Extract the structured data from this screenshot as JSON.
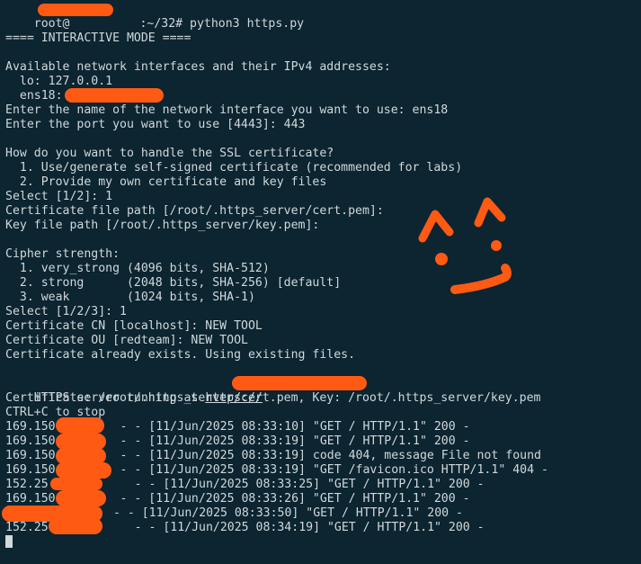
{
  "terminal": {
    "prompt_user": "root@",
    "prompt_path": ":~/32# ",
    "command": "python3 https.py",
    "mode_banner": "==== INTERACTIVE MODE ====",
    "iface_header": "Available network interfaces and their IPv4 addresses:",
    "iface_lo": "  lo: 127.0.0.1",
    "iface_ens18": "  ens18: ",
    "ask_iface": "Enter the name of the network interface you want to use: ens18",
    "ask_port": "Enter the port you want to use [4443]: 443",
    "ssl_question": "How do you want to handle the SSL certificate?",
    "ssl_opt1": "  1. Use/generate self-signed certificate (recommended for labs)",
    "ssl_opt2": "  2. Provide my own certificate and key files",
    "ssl_select": "Select [1/2]: 1",
    "cert_path": "Certificate file path [/root/.https_server/cert.pem]:",
    "key_path": "Key file path [/root/.https_server/key.pem]:",
    "cipher_header": "Cipher strength:",
    "cipher_1": "  1. very_strong (4096 bits, SHA-512)",
    "cipher_2": "  2. strong      (2048 bits, SHA-256) [default]",
    "cipher_3": "  3. weak        (1024 bits, SHA-1)",
    "cipher_select": "Select [1/2/3]: 1",
    "cert_cn": "Certificate CN [localhost]: NEW TOOL",
    "cert_ou": "Certificate OU [redteam]: NEW TOOL",
    "cert_exists": "Certificate already exists. Using existing files.",
    "running_prefix": "HTTPS server running at ",
    "running_link": "https://",
    "cert_key_info": "Certificate: /root/.https_server/cert.pem, Key: /root/.https_server/key.pem",
    "ctrl_c": "CTRL+C to stop",
    "logs": [
      {
        "ip": "169.150",
        "rest": " - - [11/Jun/2025 08:33:10] \"GET / HTTP/1.1\" 200 -"
      },
      {
        "ip": "169.150",
        "rest": " - - [11/Jun/2025 08:33:19] \"GET / HTTP/1.1\" 200 -"
      },
      {
        "ip": "169.150",
        "rest": " - - [11/Jun/2025 08:33:19] code 404, message File not found"
      },
      {
        "ip": "169.150",
        "rest": " - - [11/Jun/2025 08:33:19] \"GET /favicon.ico HTTP/1.1\" 404 -"
      },
      {
        "ip": "152.25",
        "rest": " - - [11/Jun/2025 08:33:25] \"GET / HTTP/1.1\" 200 -"
      },
      {
        "ip": "169.150",
        "rest": " - - [11/Jun/2025 08:33:26] \"GET / HTTP/1.1\" 200 -"
      },
      {
        "ip": "",
        "rest": " - - [11/Jun/2025 08:33:50] \"GET / HTTP/1.1\" 200 -"
      },
      {
        "ip": "152.25",
        "rest": " - - [11/Jun/2025 08:34:19] \"GET / HTTP/1.1\" 200 -"
      }
    ]
  },
  "colors": {
    "background": "#0c2530",
    "text": "#cfd8dc",
    "redaction": "#ff5a14"
  }
}
